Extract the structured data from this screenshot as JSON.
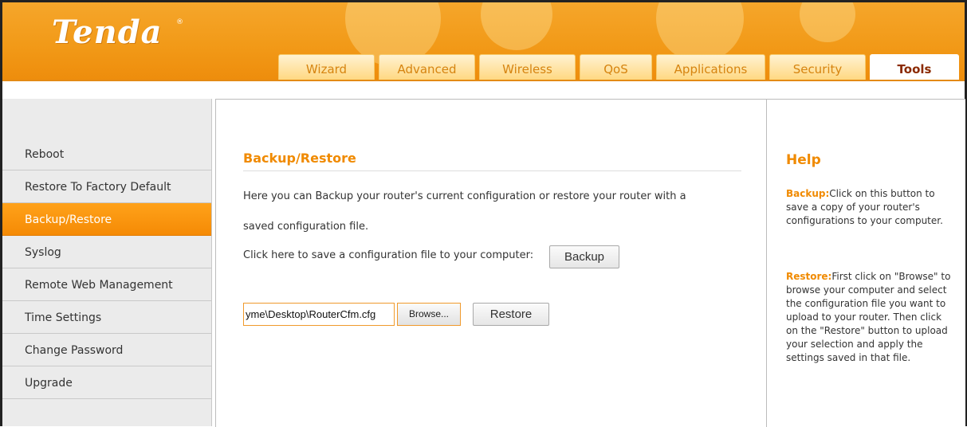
{
  "brand": {
    "logo_text": "Tenda",
    "reg_mark": "®"
  },
  "nav": {
    "tabs": [
      {
        "label": "Wizard"
      },
      {
        "label": "Advanced"
      },
      {
        "label": "Wireless"
      },
      {
        "label": "QoS"
      },
      {
        "label": "Applications"
      },
      {
        "label": "Security"
      },
      {
        "label": "Tools"
      }
    ],
    "active_tab": "Tools"
  },
  "sidebar": {
    "items": [
      {
        "label": "Reboot"
      },
      {
        "label": "Restore To Factory Default"
      },
      {
        "label": "Backup/Restore"
      },
      {
        "label": "Syslog"
      },
      {
        "label": "Remote Web Management"
      },
      {
        "label": "Time Settings"
      },
      {
        "label": "Change Password"
      },
      {
        "label": "Upgrade"
      }
    ],
    "active_item": "Backup/Restore"
  },
  "main": {
    "title": "Backup/Restore",
    "desc_line1": "Here you can Backup your router's current configuration or restore your router with a",
    "desc_line2": "saved configuration file.",
    "backup_prompt": "Click here to save a configuration file to your computer:",
    "backup_button": "Backup",
    "file_value": "yme\\Desktop\\RouterCfm.cfg",
    "browse_button": "Browse...",
    "restore_button": "Restore"
  },
  "help": {
    "title": "Help",
    "backup_key": "Backup:",
    "backup_text": "Click on this button to save a copy of your router's configurations to your computer.",
    "restore_key": "Restore:",
    "restore_text": "First click on \"Browse\" to browse your computer and select the configuration file you want to upload to your router. Then click on the \"Restore\" button to  upload your selection and apply the settings saved in that file."
  },
  "colors": {
    "brand_orange": "#f29a18",
    "accent_text": "#f08a00",
    "active_tab_text": "#8b2a00",
    "sidebar_bg": "#ebebeb"
  }
}
